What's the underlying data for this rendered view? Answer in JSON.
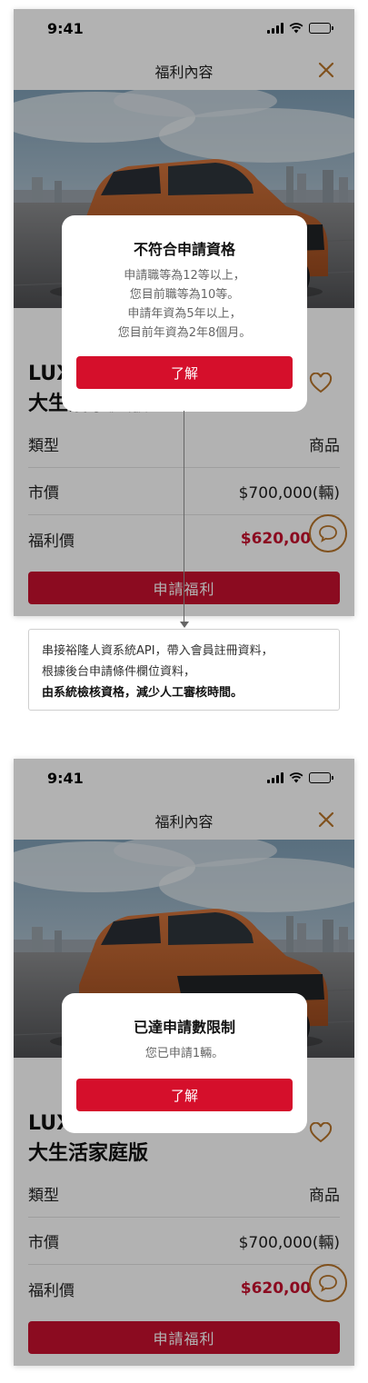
{
  "colors": {
    "accent": "#c8102e",
    "icon_gold": "#b8742a",
    "overlay": "rgba(0,0,0,0.30)"
  },
  "screens": [
    {
      "status": {
        "time": "9:41"
      },
      "nav": {
        "title": "福利內容",
        "close_icon": "close-icon"
      },
      "product": {
        "title_line1": "LUXGEN URX",
        "title_line2": "大生活家庭版"
      },
      "rows": [
        {
          "label": "類型",
          "value": "商品"
        },
        {
          "label": "市價",
          "value": "$700,000(輛)"
        },
        {
          "label": "福利價",
          "value": "$620,000"
        }
      ],
      "apply_label": "申請福利",
      "dialog": {
        "title": "不符合申請資格",
        "lines": [
          "申請職等為12等以上，",
          "您目前職等為10等。",
          "申請年資為5年以上，",
          "您目前年資為2年8個月。"
        ],
        "button": "了解"
      }
    },
    {
      "status": {
        "time": "9:41"
      },
      "nav": {
        "title": "福利內容",
        "close_icon": "close-icon"
      },
      "product": {
        "title_line1": "LUXGEN URX",
        "title_line2": "大生活家庭版"
      },
      "rows": [
        {
          "label": "類型",
          "value": "商品"
        },
        {
          "label": "市價",
          "value": "$700,000(輛)"
        },
        {
          "label": "福利價",
          "value": "$620,000"
        }
      ],
      "apply_label": "申請福利",
      "dialog": {
        "title": "已達申請數限制",
        "lines": [
          "您已申請1輛。"
        ],
        "button": "了解"
      }
    }
  ],
  "annotation": {
    "line1": "串接裕隆人資系統API，帶入會員註冊資料，",
    "line2": "根據後台申請條件欄位資料，",
    "line3": "由系統檢核資格，減少人工審核時間。"
  }
}
